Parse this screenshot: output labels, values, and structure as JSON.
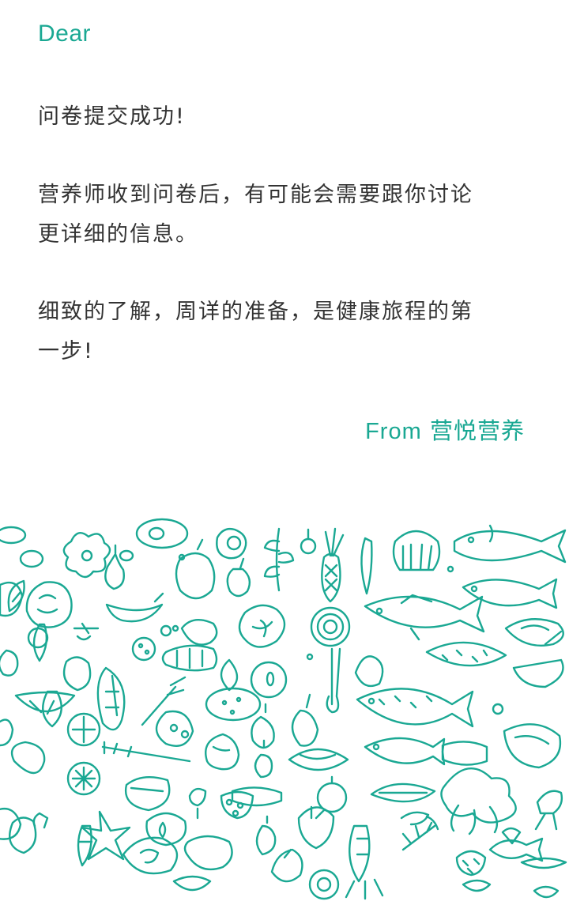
{
  "letter": {
    "greeting": "Dear",
    "paragraphs": [
      "问卷提交成功!",
      "营养师收到问卷后，有可能会需要跟你讨论\n更详细的信息。",
      "细致的了解，周详的准备，是健康旅程的第\n一步!"
    ],
    "signature_from": "From",
    "signature_name": "营悦营养"
  },
  "colors": {
    "accent": "#1aa893",
    "text": "#333333",
    "background": "#ffffff"
  },
  "illustration": {
    "icon": "food-doodle-pattern-icon"
  }
}
